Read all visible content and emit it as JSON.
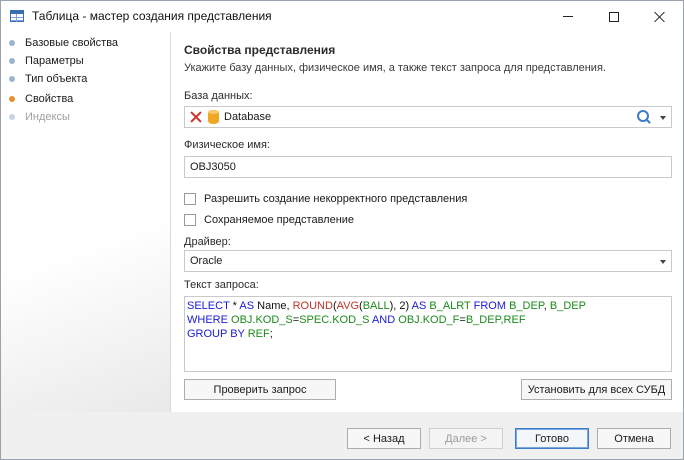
{
  "window": {
    "title": "Таблица - мастер создания представления"
  },
  "sidebar": {
    "items": [
      {
        "label": "Базовые свойства",
        "state": "done"
      },
      {
        "label": "Параметры",
        "state": "done"
      },
      {
        "label": "Тип объекта",
        "state": "done"
      },
      {
        "label": "Свойства",
        "state": "current"
      },
      {
        "label": "Индексы",
        "state": "future"
      }
    ]
  },
  "main": {
    "title": "Свойства представления",
    "subtitle": "Укажите базу данных, физическое имя, а также текст запроса для представления.",
    "database": {
      "label": "База данных:",
      "value": "Database"
    },
    "physical_name": {
      "label": "Физическое имя:",
      "value": "OBJ3050"
    },
    "checkboxes": [
      {
        "label": "Разрешить создание некорректного представления",
        "checked": false
      },
      {
        "label": "Сохраняемое представление",
        "checked": false
      }
    ],
    "driver": {
      "label": "Драйвер:",
      "value": "Oracle"
    },
    "query": {
      "label": "Текст запроса:",
      "lines": [
        [
          {
            "t": "SELECT",
            "c": "kw"
          },
          {
            "t": " * ",
            "c": "pl"
          },
          {
            "t": "AS",
            "c": "kw"
          },
          {
            "t": " Name, ",
            "c": "pl"
          },
          {
            "t": "ROUND",
            "c": "fn"
          },
          {
            "t": "(",
            "c": "pl"
          },
          {
            "t": "AVG",
            "c": "fn"
          },
          {
            "t": "(",
            "c": "pl"
          },
          {
            "t": "BALL",
            "c": "id"
          },
          {
            "t": "), 2) ",
            "c": "pl"
          },
          {
            "t": "AS",
            "c": "kw"
          },
          {
            "t": " ",
            "c": "pl"
          },
          {
            "t": "B_ALRT",
            "c": "id"
          },
          {
            "t": " ",
            "c": "pl"
          },
          {
            "t": "FROM",
            "c": "kw"
          },
          {
            "t": " ",
            "c": "pl"
          },
          {
            "t": "B_DEP",
            "c": "id"
          },
          {
            "t": ", ",
            "c": "pl"
          },
          {
            "t": "B_DEP",
            "c": "id"
          }
        ],
        [
          {
            "t": "WHERE",
            "c": "kw"
          },
          {
            "t": " ",
            "c": "pl"
          },
          {
            "t": "OBJ.KOD_S",
            "c": "id"
          },
          {
            "t": "=",
            "c": "pl"
          },
          {
            "t": "SPEC.KOD_S",
            "c": "id"
          },
          {
            "t": " ",
            "c": "pl"
          },
          {
            "t": "AND",
            "c": "kw"
          },
          {
            "t": " ",
            "c": "pl"
          },
          {
            "t": "OBJ.KOD_F",
            "c": "id"
          },
          {
            "t": "=",
            "c": "pl"
          },
          {
            "t": "B_DEP,REF",
            "c": "id"
          }
        ],
        [
          {
            "t": "GROUP BY",
            "c": "kw"
          },
          {
            "t": " ",
            "c": "pl"
          },
          {
            "t": "REF",
            "c": "id"
          },
          {
            "t": ";",
            "c": "pl"
          }
        ]
      ]
    },
    "check_query_button": "Проверить запрос",
    "set_all_dbms_button": "Установить для всех СУБД"
  },
  "footer": {
    "back": "< Назад",
    "next": "Далее >",
    "finish": "Готово",
    "cancel": "Отмена"
  },
  "colors": {
    "keyword": "#1a1ad6",
    "function": "#c0322b",
    "identifier": "#1a8a1a",
    "current_step": "#e8912d"
  }
}
